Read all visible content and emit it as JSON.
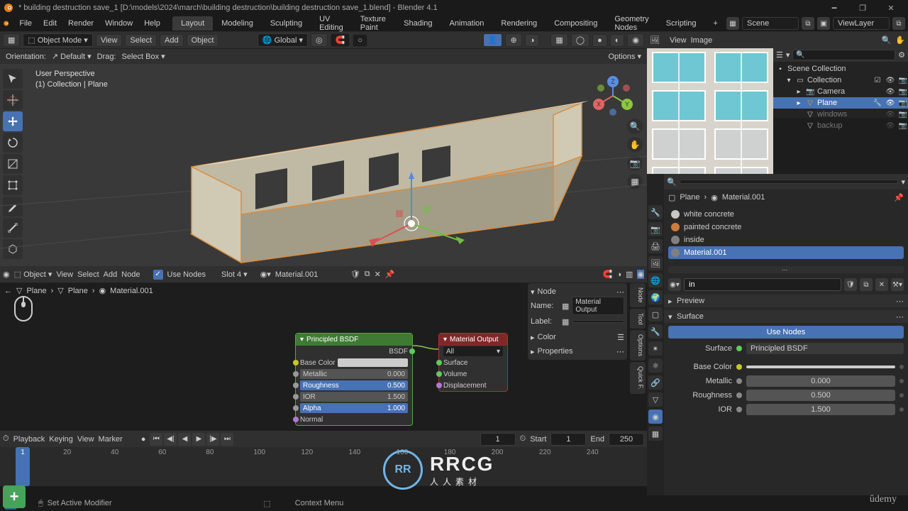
{
  "window": {
    "title": "* building destruction save_1 [D:\\models\\2024\\march\\building destruction\\building destruction save_1.blend] - Blender 4.1"
  },
  "menus": {
    "items": [
      "File",
      "Edit",
      "Render",
      "Window",
      "Help"
    ]
  },
  "workspace_tabs": {
    "items": [
      "Layout",
      "Modeling",
      "Sculpting",
      "UV Editing",
      "Texture Paint",
      "Shading",
      "Animation",
      "Rendering",
      "Compositing",
      "Geometry Nodes",
      "Scripting"
    ],
    "active": "Layout",
    "plus": "+"
  },
  "header_right": {
    "scene_label": "Scene",
    "viewlayer_label": "ViewLayer"
  },
  "viewport": {
    "header": {
      "editor_icon": "▦",
      "mode": "Object Mode",
      "menus": [
        "View",
        "Select",
        "Add",
        "Object"
      ],
      "transform_orient": "Global",
      "pivot_icon": "◎",
      "snap_icon": "🧲",
      "prop_icon": "○"
    },
    "subheader": {
      "orientation_lbl": "Orientation:",
      "orientation_val": "Default",
      "drag_lbl": "Drag:",
      "drag_val": "Select Box",
      "options_lbl": "Options"
    },
    "overlay": {
      "l1": "User Perspective",
      "l2": "(1) Collection | Plane"
    },
    "gizmo": {
      "x": "X",
      "y": "Y",
      "z": "Z"
    }
  },
  "image_editor": {
    "menus": [
      "View",
      "Image"
    ]
  },
  "outliner": {
    "search_placeholder": "Search",
    "root": "Scene Collection",
    "collection": "Collection",
    "items": [
      {
        "name": "Camera",
        "sel": false
      },
      {
        "name": "Plane",
        "sel": true
      },
      {
        "name": "windows",
        "sel": false
      },
      {
        "name": "backup",
        "sel": false
      }
    ]
  },
  "properties": {
    "search_icon": "🔍",
    "search_placeholder": "Search",
    "breadcrumb_obj": "Plane",
    "breadcrumb_mat": "Material.001",
    "materials": [
      {
        "label": "white concrete",
        "swatch": "#c7c7c7",
        "sel": false
      },
      {
        "label": "painted concrete",
        "swatch": "#d07a3d",
        "sel": false
      },
      {
        "label": "inside",
        "swatch": "#808080",
        "sel": false
      },
      {
        "label": "Material.001",
        "swatch": "#808080",
        "sel": true
      }
    ],
    "mat_name_input": "in",
    "preview_label": "Preview",
    "surface_label": "Surface",
    "use_nodes": "Use Nodes",
    "surface_socket_label": "Surface",
    "surface_socket_value": "Principled BSDF",
    "rows": [
      {
        "label": "Base Color",
        "value": "",
        "color": true
      },
      {
        "label": "Metallic",
        "value": "0.000"
      },
      {
        "label": "Roughness",
        "value": "0.500"
      },
      {
        "label": "IOR",
        "value": "1.500"
      }
    ]
  },
  "node_editor": {
    "header": {
      "mode": "Object",
      "menus": [
        "View",
        "Select",
        "Add",
        "Node"
      ],
      "use_nodes_label": "Use Nodes",
      "slot": "Slot 4",
      "mat": "Material.001"
    },
    "crumb": [
      "Plane",
      "Plane",
      "Material.001"
    ],
    "bsdf": {
      "title": "Principled BSDF",
      "out": "BSDF",
      "rows": [
        {
          "label": "Base Color",
          "value": "",
          "color": true
        },
        {
          "label": "Metallic",
          "value": "0.000"
        },
        {
          "label": "Roughness",
          "value": "0.500",
          "sel": true
        },
        {
          "label": "IOR",
          "value": "1.500"
        },
        {
          "label": "Alpha",
          "value": "1.000",
          "sel": true
        },
        {
          "label": "Normal"
        }
      ]
    },
    "output": {
      "title": "Material Output",
      "rows": [
        "All",
        "Surface",
        "Volume",
        "Displacement"
      ]
    },
    "side": {
      "node_label": "Node",
      "name_lbl": "Name:",
      "name_val": "Material Output",
      "label_lbl": "Label:",
      "color_lbl": "Color",
      "properties_lbl": "Properties"
    }
  },
  "timeline": {
    "header": {
      "menus": [
        "Playback",
        "Keying",
        "View",
        "Marker"
      ],
      "cur_frame": "1",
      "start_lbl": "Start",
      "start": "1",
      "end_lbl": "End",
      "end": "250"
    },
    "marks": [
      20,
      40,
      60,
      80,
      100,
      120,
      140,
      160,
      180,
      200,
      220,
      240
    ],
    "cursor": "1"
  },
  "status": {
    "modifier": "Set Active Modifier",
    "context": "Context Menu"
  },
  "watermark": {
    "logo": "RR",
    "big": "RRCG",
    "small": "人人素材"
  },
  "udemy": "ûdemy"
}
